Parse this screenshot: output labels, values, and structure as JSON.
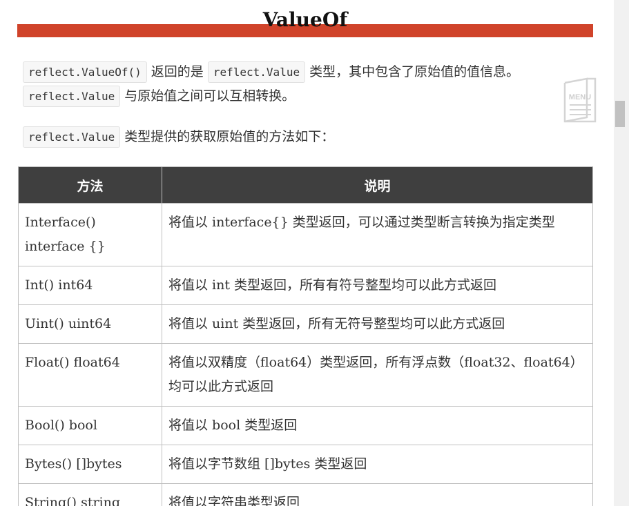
{
  "heading": {
    "title": "ValueOf"
  },
  "intro": {
    "code1": "reflect.ValueOf()",
    "text1": " 返回的是 ",
    "code2": "reflect.Value",
    "text2": " 类型，其中包含了原始值的值信息。",
    "code3": "reflect.Value",
    "text3": " 与原始值之间可以互相转换。"
  },
  "methods_intro": {
    "code": "reflect.Value",
    "text": " 类型提供的获取原始值的方法如下："
  },
  "table": {
    "headers": [
      "方法",
      "说明"
    ],
    "rows": [
      {
        "method": "Interface() interface {}",
        "desc": "将值以 interface{} 类型返回，可以通过类型断言转换为指定类型"
      },
      {
        "method": "Int() int64",
        "desc": "将值以 int 类型返回，所有有符号整型均可以此方式返回"
      },
      {
        "method": "Uint() uint64",
        "desc": "将值以 uint 类型返回，所有无符号整型均可以此方式返回"
      },
      {
        "method": "Float() float64",
        "desc": "将值以双精度（float64）类型返回，所有浮点数（float32、float64）均可以此方式返回"
      },
      {
        "method": "Bool() bool",
        "desc": "将值以 bool 类型返回"
      },
      {
        "method": "Bytes() []bytes",
        "desc": "将值以字节数组 []bytes 类型返回"
      },
      {
        "method": "String() string",
        "desc": "将值以字符串类型返回"
      }
    ]
  },
  "menu_icon": {
    "label": "MENU",
    "icon": "menu-book-icon"
  },
  "colors": {
    "accent_bar": "#d0432a",
    "table_header": "#3f3f3f"
  }
}
